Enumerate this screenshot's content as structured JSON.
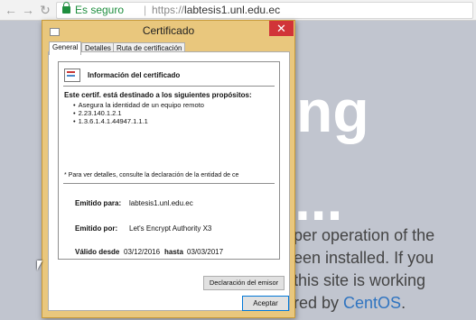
{
  "browser": {
    "back_icon": "arrow-left-icon",
    "forward_icon": "arrow-right-icon",
    "reload_icon": "reload-icon",
    "back_glyph": "←",
    "forward_glyph": "→",
    "reload_glyph": "↻",
    "secure_label": "Es seguro",
    "separator": "|",
    "url_protocol": "https://",
    "url_host": "labtesis1.unl.edu.ec",
    "secure_color": "#1e8e3e"
  },
  "page": {
    "heading": "ng",
    "dots": "...",
    "paragraph_lines": [
      "per operation of the",
      "een installed. If you",
      "this site is working"
    ],
    "last_line_prefix": "red by ",
    "last_line_link": "CentOS",
    "last_line_suffix": ".",
    "link_color": "#2f74c0"
  },
  "dialog": {
    "title": "Certificado",
    "close_glyph": "✕",
    "tabs": [
      "General",
      "Detalles",
      "Ruta de certificación"
    ],
    "active_tab": "General",
    "info_title": "Información del certificado",
    "purpose_heading": "Este certif. está destinado a los siguientes propósitos:",
    "purposes": [
      "Asegura la identidad de un equipo remoto",
      "2.23.140.1.2.1",
      "1.3.6.1.4.1.44947.1.1.1"
    ],
    "note": "* Para ver detalles, consulte la declaración de la entidad de ce",
    "issued_to_label": "Emitido para:",
    "issued_to_value": "labtesis1.unl.edu.ec",
    "issued_by_label": "Emitido por:",
    "issued_by_value": "Let's Encrypt Authority X3",
    "valid_from_label": "Válido desde",
    "valid_from_value": "03/12/2016",
    "valid_to_label": "hasta",
    "valid_to_value": "03/03/2017",
    "statement_button": "Declaración del emisor",
    "accept_button": "Aceptar",
    "frame_color": "#e9c77d"
  }
}
